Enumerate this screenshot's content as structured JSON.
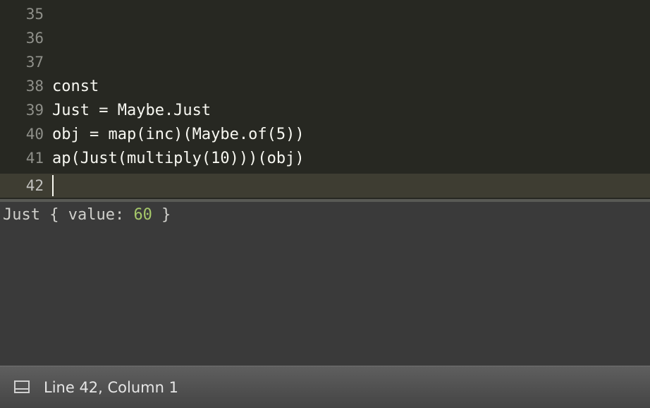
{
  "editor": {
    "lines": [
      {
        "number": "35",
        "text": ""
      },
      {
        "number": "36",
        "text": ""
      },
      {
        "number": "37",
        "text": ""
      },
      {
        "number": "38",
        "text": "const"
      },
      {
        "number": "39",
        "text": "Just = Maybe.Just"
      },
      {
        "number": "40",
        "text": "obj = map(inc)(Maybe.of(5))"
      },
      {
        "number": "41",
        "text": "ap(Just(multiply(10)))(obj)"
      },
      {
        "number": "42",
        "text": ""
      }
    ]
  },
  "console": {
    "output_prefix": "Just { value: ",
    "output_value": "60",
    "output_suffix": " }"
  },
  "statusbar": {
    "position": "Line 42, Column 1",
    "panel_icon": "panel-toggle-icon"
  },
  "colors": {
    "editor_bg": "#272822",
    "current_line_bg": "#3e3d32",
    "console_bg": "#3a3a3a",
    "number_color": "#a6c86a"
  }
}
